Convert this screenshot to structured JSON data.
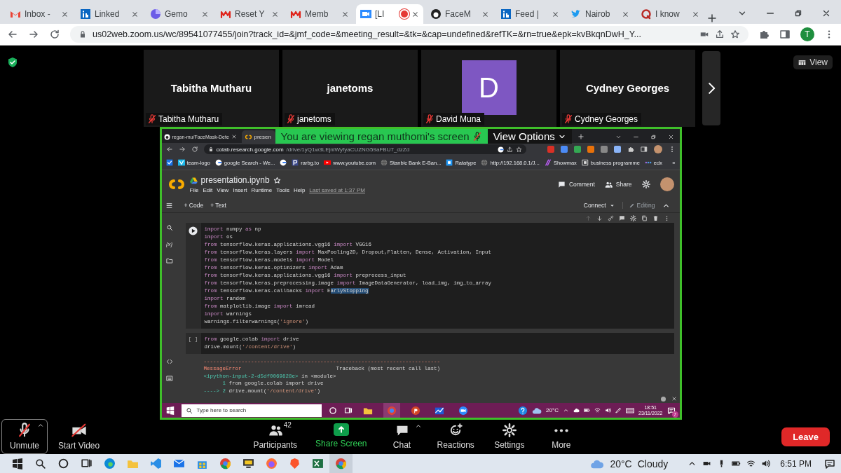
{
  "browser": {
    "tabs": [
      {
        "label": "Inbox -",
        "selected": false,
        "recording": false
      },
      {
        "label": "Linked",
        "selected": false,
        "recording": false
      },
      {
        "label": "Gemo",
        "selected": false,
        "recording": false
      },
      {
        "label": "Reset Y",
        "selected": false,
        "recording": false
      },
      {
        "label": "Memb",
        "selected": false,
        "recording": false
      },
      {
        "label": "[LI",
        "selected": true,
        "recording": true
      },
      {
        "label": "FaceM",
        "selected": false,
        "recording": false
      },
      {
        "label": "Feed |",
        "selected": false,
        "recording": false
      },
      {
        "label": "Nairob",
        "selected": false,
        "recording": false
      },
      {
        "label": "I know",
        "selected": false,
        "recording": false
      }
    ],
    "url": "us02web.zoom.us/wc/89541077455/join?track_id=&jmf_code=&meeting_result=&tk=&cap=undefined&refTK=&rn=true&epk=kvBkqnDwH_Y...",
    "profile_initial": "T"
  },
  "meeting": {
    "participants": [
      {
        "kind": "name",
        "name": "Tabitha Mutharu",
        "label": "Tabitha Mutharu",
        "muted": true
      },
      {
        "kind": "name",
        "name": "janetoms",
        "label": "janetoms",
        "muted": true
      },
      {
        "kind": "avatar",
        "initial": "D",
        "color": "#7e57c2",
        "label": "David Muna",
        "muted": true
      },
      {
        "kind": "name",
        "name": "Cydney Georges",
        "label": "Cydney Georges",
        "muted": true
      }
    ],
    "view": "View"
  },
  "share": {
    "banner": "You are viewing regan muthomi's screen",
    "view_options": "View Options",
    "browser": {
      "tabs": [
        {
          "label": "regan-mu/FaceMask-Dete",
          "selected": false
        },
        {
          "label": "presen",
          "selected": true
        }
      ],
      "url_host": "colab.research.google.com",
      "url_path": "/drive/1yQ1w3LEjnlWyfyaCUZNG59aFBU7_dzZd",
      "bookmarks": [
        {
          "kind": "icon"
        },
        {
          "kind": "link",
          "label": "team-logo"
        },
        {
          "kind": "link",
          "label": "google Search - We..."
        },
        {
          "kind": "icon"
        },
        {
          "kind": "link",
          "label": "rarbg.to"
        },
        {
          "kind": "link",
          "label": "www.youtube.com"
        },
        {
          "kind": "link",
          "label": "Stanbic Bank E-Ban..."
        },
        {
          "kind": "link",
          "label": "Ratatype"
        },
        {
          "kind": "link",
          "label": "http://192.168.0.1/J..."
        },
        {
          "kind": "link",
          "label": "Showmax"
        },
        {
          "kind": "link",
          "label": "business programme"
        },
        {
          "kind": "link",
          "label": "edx"
        }
      ],
      "more": "»"
    },
    "notebook": {
      "title": "presentation.ipynb",
      "menu": [
        "File",
        "Edit",
        "View",
        "Insert",
        "Runtime",
        "Tools",
        "Help"
      ],
      "last_saved": "Last saved at 1:37 PM",
      "comment": "Comment",
      "share": "Share",
      "add_code": "+ Code",
      "add_text": "+ Text",
      "connect": "Connect",
      "editing": "Editing",
      "variables": "{x}",
      "cells": [
        {
          "focused": true,
          "lines": [
            [
              {
                "kind": "keyword",
                "text": "import"
              },
              {
                "kind": "plain",
                "text": " numpy "
              },
              {
                "kind": "keyword",
                "text": "as"
              },
              {
                "kind": "plain",
                "text": " np"
              }
            ],
            [
              {
                "kind": "keyword",
                "text": "import"
              },
              {
                "kind": "plain",
                "text": " os"
              }
            ],
            [
              {
                "kind": "keyword",
                "text": "from"
              },
              {
                "kind": "plain",
                "text": " tensorflow.keras.applications.vgg16 "
              },
              {
                "kind": "keyword",
                "text": "import"
              },
              {
                "kind": "plain",
                "text": " VGG16"
              }
            ],
            [
              {
                "kind": "keyword",
                "text": "from"
              },
              {
                "kind": "plain",
                "text": " tensorflow.keras.layers "
              },
              {
                "kind": "keyword",
                "text": "import"
              },
              {
                "kind": "plain",
                "text": " MaxPooling2D, Dropout,Flatten, Dense, Activation, Input"
              }
            ],
            [
              {
                "kind": "keyword",
                "text": "from"
              },
              {
                "kind": "plain",
                "text": " tensorflow.keras.models "
              },
              {
                "kind": "keyword",
                "text": "import"
              },
              {
                "kind": "plain",
                "text": " Model"
              }
            ],
            [
              {
                "kind": "keyword",
                "text": "from"
              },
              {
                "kind": "plain",
                "text": " tensorflow.keras.optimizers "
              },
              {
                "kind": "keyword",
                "text": "import"
              },
              {
                "kind": "plain",
                "text": " Adam"
              }
            ],
            [
              {
                "kind": "keyword",
                "text": "from"
              },
              {
                "kind": "plain",
                "text": " tensorflow.keras.applications.vgg16 "
              },
              {
                "kind": "keyword",
                "text": "import"
              },
              {
                "kind": "plain",
                "text": " preprocess_input"
              }
            ],
            [
              {
                "kind": "keyword",
                "text": "from"
              },
              {
                "kind": "plain",
                "text": " tensorflow.keras.preprocessing.image "
              },
              {
                "kind": "keyword",
                "text": "import"
              },
              {
                "kind": "plain",
                "text": " ImageDataGenerator, load_img, img_to_array"
              }
            ],
            [
              {
                "kind": "keyword",
                "text": "from"
              },
              {
                "kind": "plain",
                "text": " tensorflow.keras.callbacks "
              },
              {
                "kind": "keyword",
                "text": "import"
              },
              {
                "kind": "plain",
                "text": " E"
              },
              {
                "kind": "selected",
                "text": "arlyStopping"
              }
            ],
            [
              {
                "kind": "keyword",
                "text": "import"
              },
              {
                "kind": "plain",
                "text": " random"
              }
            ],
            [
              {
                "kind": "keyword",
                "text": "from"
              },
              {
                "kind": "plain",
                "text": " matplotlib.image "
              },
              {
                "kind": "keyword",
                "text": "import"
              },
              {
                "kind": "plain",
                "text": " imread"
              }
            ],
            [
              {
                "kind": "keyword",
                "text": "import"
              },
              {
                "kind": "plain",
                "text": " warnings"
              }
            ],
            [
              {
                "kind": "plain",
                "text": "warnings.filterwarnings("
              },
              {
                "kind": "string",
                "text": "'ignore'"
              },
              {
                "kind": "plain",
                "text": ")"
              }
            ]
          ]
        },
        {
          "focused": false,
          "prompt": "[ ]",
          "lines": [
            [
              {
                "kind": "keyword",
                "text": "from"
              },
              {
                "kind": "plain",
                "text": " google.colab "
              },
              {
                "kind": "keyword",
                "text": "import"
              },
              {
                "kind": "plain",
                "text": " drive"
              }
            ],
            [
              {
                "kind": "plain",
                "text": "drive.mount("
              },
              {
                "kind": "string",
                "text": "'/content/drive'"
              },
              {
                "kind": "plain",
                "text": ")"
              }
            ]
          ]
        }
      ],
      "output": [
        [
          {
            "kind": "error",
            "text": "---------------------------------------------------------------------------"
          }
        ],
        [
          {
            "kind": "error",
            "text": "MessageError"
          },
          {
            "kind": "plain",
            "text": "                              Traceback (most recent call last)"
          }
        ],
        [
          {
            "kind": "frame",
            "text": "<ipython-input-2-d5df0069828e>"
          },
          {
            "kind": "plain",
            "text": " in <module>"
          }
        ],
        [
          {
            "kind": "frame",
            "text": "      1 "
          },
          {
            "kind": "plain",
            "text": "from google.colab import drive"
          }
        ],
        [
          {
            "kind": "frame",
            "text": "----> 2 "
          },
          {
            "kind": "plain",
            "text": "drive.mount("
          },
          {
            "kind": "string",
            "text": "'/content/drive'"
          },
          {
            "kind": "plain",
            "text": ")"
          }
        ]
      ]
    },
    "taskbar": {
      "search_placeholder": "Type here to search",
      "temperature": "20°C",
      "time": "18:51",
      "date": "23/11/2022",
      "notifications": "7"
    }
  },
  "toolbar": {
    "left": [
      {
        "label": "Unmute",
        "focused": true,
        "menu": true
      },
      {
        "label": "Start Video",
        "focused": false,
        "menu": false
      }
    ],
    "center": [
      {
        "label": "Participants",
        "kind": "normal",
        "count": "42",
        "menu": false
      },
      {
        "label": "Share Screen",
        "kind": "share",
        "menu": false
      },
      {
        "label": "Chat",
        "kind": "normal",
        "menu": true
      },
      {
        "label": "Reactions",
        "kind": "normal",
        "menu": false
      },
      {
        "label": "Settings",
        "kind": "normal",
        "menu": false
      },
      {
        "label": "More",
        "kind": "normal",
        "menu": false
      }
    ],
    "leave": "Leave"
  },
  "windows": {
    "temperature": "20°C",
    "condition": "Cloudy",
    "time": "6:51 PM"
  }
}
